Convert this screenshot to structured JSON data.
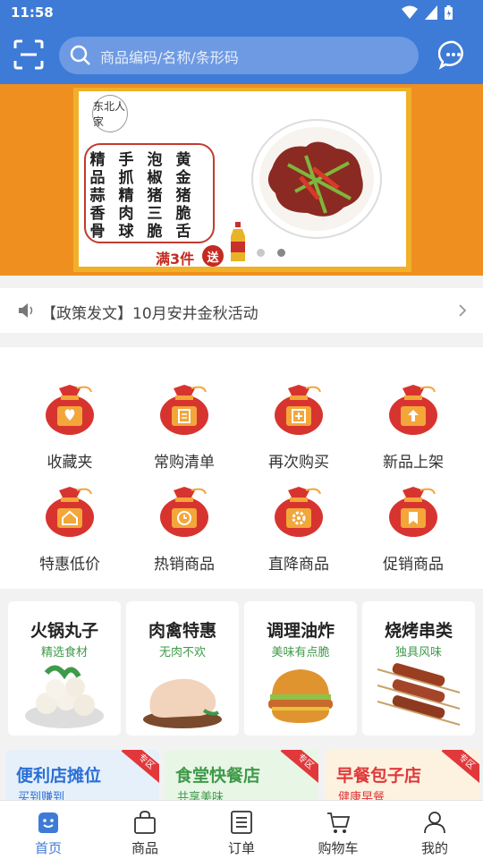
{
  "status": {
    "time": "11:58"
  },
  "search": {
    "placeholder": "商品编码/名称/条形码"
  },
  "banner": {
    "brand": "东北人家",
    "menu_columns": [
      [
        "精",
        "品",
        "蒜",
        "香",
        "骨"
      ],
      [
        "手",
        "抓",
        "精",
        "肉",
        "球"
      ],
      [
        "泡",
        "椒",
        "猪",
        "三",
        "脆"
      ],
      [
        "黄",
        "金",
        "猪",
        "脆",
        "舌"
      ]
    ],
    "promo": "满3件",
    "promo_badge": "送",
    "slide_count": 2,
    "active_slide": 1
  },
  "notice": {
    "text": "【政策发文】10月安井金秋活动"
  },
  "grid": [
    {
      "label": "收藏夹",
      "icon": "heart-bag-icon"
    },
    {
      "label": "常购清单",
      "icon": "bag-list-icon"
    },
    {
      "label": "再次购买",
      "icon": "bag-plus-icon"
    },
    {
      "label": "新品上架",
      "icon": "bag-upload-icon"
    },
    {
      "label": "特惠低价",
      "icon": "bag-house-icon"
    },
    {
      "label": "热销商品",
      "icon": "bag-clock-icon"
    },
    {
      "label": "直降商品",
      "icon": "bag-gear-icon"
    },
    {
      "label": "促销商品",
      "icon": "bag-bookmark-icon"
    }
  ],
  "categories": [
    {
      "title": "火锅丸子",
      "subtitle": "精选食材"
    },
    {
      "title": "肉禽特惠",
      "subtitle": "无肉不欢"
    },
    {
      "title": "调理油炸",
      "subtitle": "美味有点脆"
    },
    {
      "title": "烧烤串类",
      "subtitle": "独具风味"
    }
  ],
  "promos": [
    {
      "title": "便利店摊位",
      "subtitle": "买到赚到",
      "badge": "专区",
      "color": "#2a6fd6",
      "bg": "#e6f0fb"
    },
    {
      "title": "食堂快餐店",
      "subtitle": "共享美味",
      "badge": "专区",
      "color": "#3f9a4a",
      "bg": "#e8f6e6"
    },
    {
      "title": "早餐包子店",
      "subtitle": "健康早餐",
      "badge": "专区",
      "color": "#e0383b",
      "bg": "#fdf2df"
    }
  ],
  "tabs": [
    {
      "label": "首页",
      "icon": "home-smile-icon",
      "active": true
    },
    {
      "label": "商品",
      "icon": "shopping-bag-icon",
      "active": false
    },
    {
      "label": "订单",
      "icon": "order-list-icon",
      "active": false
    },
    {
      "label": "购物车",
      "icon": "cart-icon",
      "active": false
    },
    {
      "label": "我的",
      "icon": "user-icon",
      "active": false
    }
  ],
  "colors": {
    "primary": "#3e7bd6",
    "bag_red": "#d8342f",
    "bag_orange": "#f3a63a",
    "category_green": "#3f9a4a"
  }
}
